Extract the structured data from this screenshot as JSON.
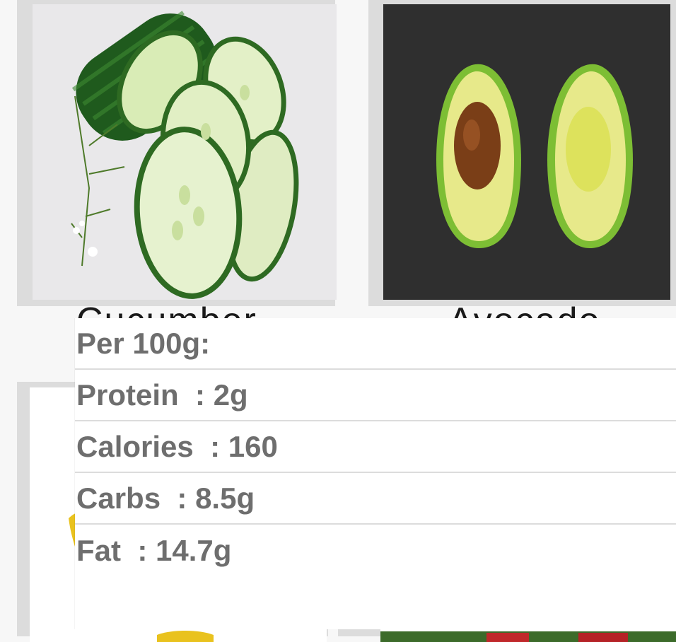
{
  "cards": [
    {
      "id": "cucumber",
      "label": "Cucumber"
    },
    {
      "id": "avocado",
      "label": "Avocado"
    },
    {
      "id": "banana",
      "label": ""
    },
    {
      "id": "salad",
      "label": ""
    }
  ],
  "nutrition": {
    "header": "Per 100g:",
    "rows": [
      {
        "name": "Protein",
        "value": "2g"
      },
      {
        "name": "Calories",
        "value": "160"
      },
      {
        "name": "Carbs",
        "value": "8.5g"
      },
      {
        "name": "Fat",
        "value": "14.7g"
      }
    ]
  },
  "colors": {
    "card_bg": "#dcdcdc",
    "popup_bg": "#ffffff",
    "popup_text": "#6e6e6e",
    "divider": "#dcdcdc"
  }
}
